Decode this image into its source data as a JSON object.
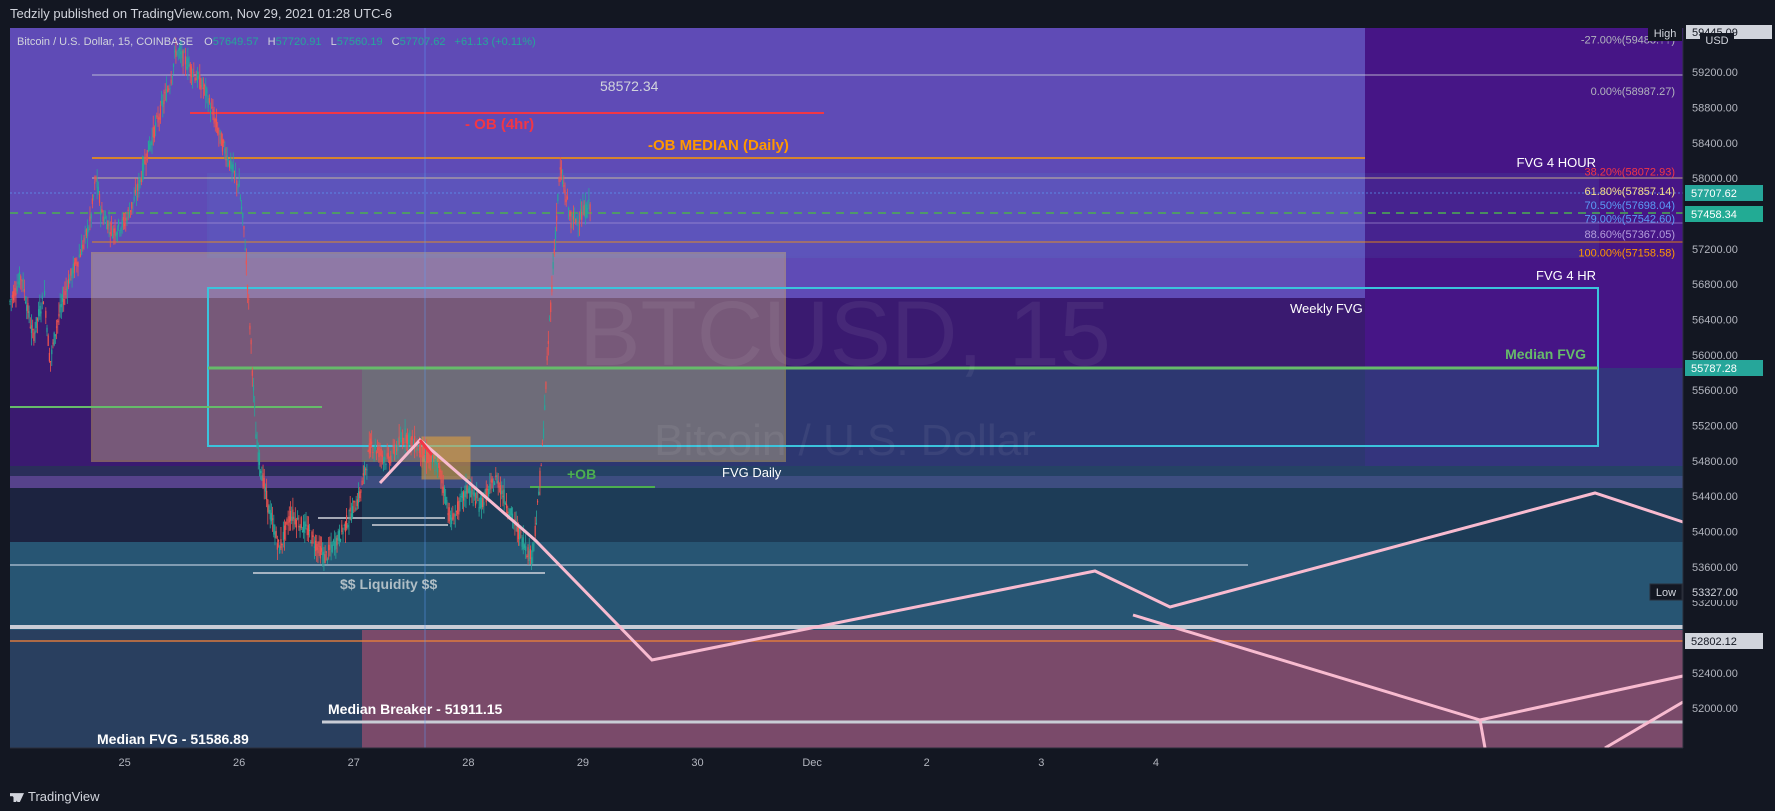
{
  "header": {
    "published": "Tedzily published on TradingView.com, Nov 29, 2021 01:28 UTC-6"
  },
  "footer": {
    "brand": "TradingView"
  },
  "legend": {
    "symbol": "Bitcoin / U.S. Dollar, 15, COINBASE",
    "o_label": "O",
    "o_value": "57649.57",
    "h_label": "H",
    "h_value": "57720.91",
    "l_label": "L",
    "l_value": "57560.19",
    "c_label": "C",
    "c_value": "57707.62",
    "change": "+61.13 (+0.11%)"
  },
  "watermark": {
    "ticker": "BTCUSD, 15",
    "name": "Bitcoin / U.S. Dollar"
  },
  "axis": {
    "currency": "USD",
    "high_label": "High",
    "high_value": "59445.09",
    "low_label": "Low",
    "low_value": "53327.00",
    "price_tag_1": "57707.62",
    "price_tag_2": "57458.34",
    "price_tag_3": "55787.28",
    "price_tag_4": "52802.12"
  },
  "annotations": {
    "line_value": "58572.34",
    "ob_4hr": "- OB (4hr)",
    "ob_median_daily": "-OB MEDIAN (Daily)",
    "fvg_4_hour": "FVG 4 HOUR",
    "fvg_4_hr": "FVG 4 HR",
    "weekly_fvg": "Weekly FVG",
    "median_fvg": "Median FVG",
    "plus_ob": "+OB",
    "fvg_daily": "FVG Daily",
    "liquidity": "$$ Liquidity $$",
    "median_breaker": "Median Breaker - 51911.15",
    "median_fvg_value": "Median FVG - 51586.89"
  },
  "fib_labels": [
    {
      "text": "-27.00%(59488.??)",
      "price": 59570,
      "color": "#b2b5be"
    },
    {
      "text": "0.00%(58987.27)",
      "price": 58987.27,
      "color": "#b2b5be"
    },
    {
      "text": "38.20%(58072.93)",
      "price": 58072.93,
      "color": "#f23645"
    },
    {
      "text": "61.80%(57857.14)",
      "price": 57857.14,
      "color": "#f7e28a"
    },
    {
      "text": "70.50%(57698.04)",
      "price": 57698.04,
      "color": "#5b9cf6"
    },
    {
      "text": "79.00%(57542.60)",
      "price": 57542.6,
      "color": "#5b9cf6"
    },
    {
      "text": "88.60%(57367.05)",
      "price": 57367.05,
      "color": "#b39ddb"
    },
    {
      "text": "100.00%(57158.58)",
      "price": 57158.58,
      "color": "#ff9800"
    }
  ],
  "chart_data": {
    "type": "candlestick",
    "symbol": "BTCUSD",
    "interval": "15",
    "exchange": "COINBASE",
    "y_axis": {
      "ticks": [
        59200,
        58800,
        58400,
        58000,
        57600,
        57200,
        56800,
        56400,
        56000,
        55600,
        55200,
        54800,
        54400,
        54000,
        53600,
        53200,
        52800,
        52400,
        52000
      ],
      "range": [
        51550,
        59700
      ]
    },
    "x_axis": {
      "tick_labels": [
        "25",
        "26",
        "27",
        "28",
        "29",
        "30",
        "Dec",
        "2",
        "3",
        "4"
      ],
      "tick_days": [
        25,
        26,
        27,
        28,
        29,
        30,
        31,
        32,
        33,
        34
      ],
      "range_days": [
        24.0,
        38.6
      ]
    },
    "price_path": [
      [
        24.0,
        56600
      ],
      [
        24.1,
        56900
      ],
      [
        24.2,
        56200
      ],
      [
        24.3,
        56700
      ],
      [
        24.35,
        55900
      ],
      [
        24.4,
        56300
      ],
      [
        24.5,
        56800
      ],
      [
        24.6,
        57100
      ],
      [
        24.7,
        57500
      ],
      [
        24.75,
        58000
      ],
      [
        24.8,
        57600
      ],
      [
        24.9,
        57400
      ],
      [
        25.0,
        57500
      ],
      [
        25.1,
        57800
      ],
      [
        25.2,
        58300
      ],
      [
        25.3,
        58700
      ],
      [
        25.4,
        59100
      ],
      [
        25.45,
        59450
      ],
      [
        25.55,
        59300
      ],
      [
        25.7,
        59000
      ],
      [
        25.85,
        58400
      ],
      [
        26.0,
        57900
      ],
      [
        26.05,
        57300
      ],
      [
        26.1,
        56200
      ],
      [
        26.15,
        55000
      ],
      [
        26.25,
        54300
      ],
      [
        26.35,
        53800
      ],
      [
        26.45,
        54200
      ],
      [
        26.6,
        54000
      ],
      [
        26.75,
        53700
      ],
      [
        26.9,
        54000
      ],
      [
        27.05,
        54400
      ],
      [
        27.15,
        55000
      ],
      [
        27.3,
        54800
      ],
      [
        27.45,
        55100
      ],
      [
        27.6,
        54900
      ],
      [
        27.75,
        54700
      ],
      [
        27.85,
        54100
      ],
      [
        28.0,
        54500
      ],
      [
        28.1,
        54300
      ],
      [
        28.25,
        54600
      ],
      [
        28.4,
        54100
      ],
      [
        28.55,
        53700
      ],
      [
        28.6,
        54200
      ],
      [
        28.65,
        55000
      ],
      [
        28.7,
        56200
      ],
      [
        28.75,
        57200
      ],
      [
        28.8,
        58100
      ],
      [
        28.85,
        57800
      ],
      [
        28.9,
        57500
      ],
      [
        29.0,
        57600
      ],
      [
        29.07,
        57707
      ]
    ],
    "candle_volatility": 180
  }
}
